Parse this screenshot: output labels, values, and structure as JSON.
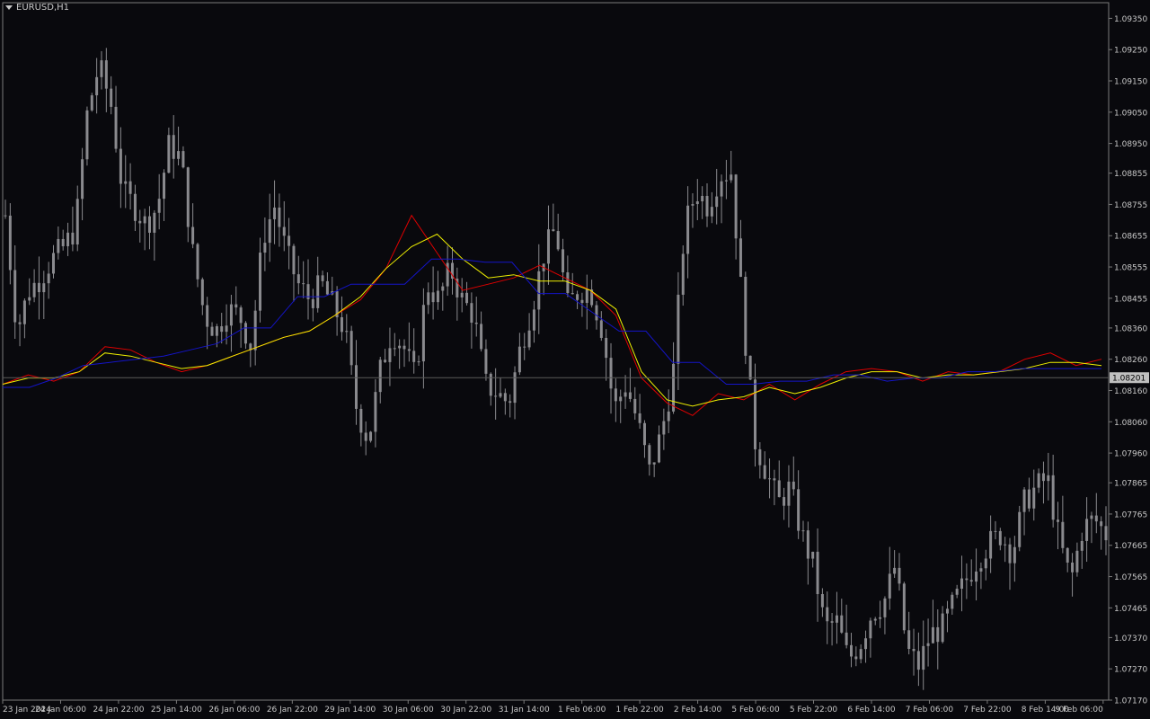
{
  "symbol_label": "EURUSD,H1",
  "colors": {
    "background": "#09090d",
    "frame": "#7a7a7a",
    "candle": "#8a8a8e",
    "text": "#c8c8c8",
    "ma_fast": "#e00000",
    "ma_mid": "#f0f000",
    "ma_step": "#1414c8",
    "price_line": "#5a5a5a",
    "price_tag_bg": "#c0c0c0",
    "price_tag_text": "#000000"
  },
  "chart_data": {
    "type": "candlestick",
    "title": "EURUSD,H1",
    "grid": false,
    "ylim": [
      1.0717,
      1.094
    ],
    "y_ticks": [
      "1.09350",
      "1.09250",
      "1.09150",
      "1.09050",
      "1.08950",
      "1.08855",
      "1.08755",
      "1.08655",
      "1.08555",
      "1.08455",
      "1.08360",
      "1.08260",
      "1.08160",
      "1.08060",
      "1.07960",
      "1.07865",
      "1.07765",
      "1.07665",
      "1.07565",
      "1.07465",
      "1.07370",
      "1.07270",
      "1.07170"
    ],
    "x_ticks": [
      "23 Jan 2024",
      "24 Jan 06:00",
      "24 Jan 22:00",
      "25 Jan 14:00",
      "26 Jan 06:00",
      "26 Jan 22:00",
      "29 Jan 14:00",
      "30 Jan 06:00",
      "30 Jan 22:00",
      "31 Jan 14:00",
      "1 Feb 06:00",
      "1 Feb 22:00",
      "2 Feb 14:00",
      "5 Feb 06:00",
      "5 Feb 22:00",
      "6 Feb 14:00",
      "7 Feb 06:00",
      "7 Feb 22:00",
      "8 Feb 14:00",
      "9 Feb 06:00"
    ],
    "current_price": "1.08201",
    "close_series": [
      1.0872,
      1.0835,
      1.0848,
      1.0852,
      1.0858,
      1.0862,
      1.0868,
      1.0905,
      1.092,
      1.0908,
      1.088,
      1.0875,
      1.0869,
      1.0875,
      1.0895,
      1.089,
      1.086,
      1.084,
      1.0835,
      1.0842,
      1.084,
      1.083,
      1.0865,
      1.0875,
      1.086,
      1.085,
      1.0845,
      1.085,
      1.0843,
      1.0835,
      1.081,
      1.08,
      1.0822,
      1.0835,
      1.083,
      1.082,
      1.085,
      1.0845,
      1.0855,
      1.0845,
      1.084,
      1.0818,
      1.0815,
      1.0812,
      1.083,
      1.0843,
      1.086,
      1.0868,
      1.0843,
      1.0848,
      1.0848,
      1.0835,
      1.081,
      1.0818,
      1.0806,
      1.079,
      1.0802,
      1.082,
      1.0868,
      1.088,
      1.0875,
      1.0885,
      1.0886,
      1.084,
      1.08,
      1.079,
      1.078,
      1.0785,
      1.077,
      1.076,
      1.074,
      1.0742,
      1.073,
      1.0735,
      1.0745,
      1.0748,
      1.076,
      1.0733,
      1.0728,
      1.0738,
      1.074,
      1.0748,
      1.0755,
      1.0762,
      1.0767,
      1.077,
      1.0764,
      1.078,
      1.0785,
      1.0788,
      1.0768,
      1.0755,
      1.0772,
      1.0775,
      1.077
    ],
    "series": [
      {
        "name": "",
        "color": "#e00000",
        "values": [
          1.0818,
          1.0821,
          1.0819,
          1.0822,
          1.083,
          1.0829,
          1.0825,
          1.0822,
          1.0824,
          1.0827,
          1.083,
          1.0833,
          1.0835,
          1.084,
          1.0845,
          1.0855,
          1.0872,
          1.086,
          1.0848,
          1.085,
          1.0852,
          1.0856,
          1.0852,
          1.0848,
          1.084,
          1.082,
          1.0812,
          1.0808,
          1.0815,
          1.0813,
          1.0818,
          1.0813,
          1.0818,
          1.0822,
          1.0823,
          1.0822,
          1.0819,
          1.0822,
          1.0821,
          1.0822,
          1.0826,
          1.0828,
          1.0824,
          1.0826
        ]
      },
      {
        "name": "",
        "color": "#f0f000",
        "values": [
          1.0818,
          1.082,
          1.082,
          1.0822,
          1.0828,
          1.0827,
          1.0825,
          1.0823,
          1.0824,
          1.0827,
          1.083,
          1.0833,
          1.0835,
          1.084,
          1.0846,
          1.0855,
          1.0862,
          1.0866,
          1.0858,
          1.0852,
          1.0853,
          1.0851,
          1.0851,
          1.0848,
          1.0842,
          1.0822,
          1.0813,
          1.0811,
          1.0813,
          1.0814,
          1.0817,
          1.0815,
          1.0817,
          1.082,
          1.0822,
          1.0822,
          1.082,
          1.0821,
          1.0821,
          1.0822,
          1.0823,
          1.0825,
          1.0825,
          1.0824
        ]
      },
      {
        "name": "",
        "color": "#1414c8",
        "values": [
          1.0817,
          1.0817,
          1.082,
          1.0824,
          1.0825,
          1.0826,
          1.0827,
          1.0829,
          1.0831,
          1.0836,
          1.0836,
          1.0846,
          1.0846,
          1.085,
          1.085,
          1.085,
          1.0858,
          1.0858,
          1.0857,
          1.0857,
          1.0847,
          1.0847,
          1.0841,
          1.0835,
          1.0835,
          1.0825,
          1.0825,
          1.0818,
          1.0818,
          1.0819,
          1.0819,
          1.0821,
          1.0821,
          1.0819,
          1.082,
          1.082,
          1.0822,
          1.0822,
          1.0823,
          1.0823,
          1.0823,
          1.0823
        ]
      }
    ]
  }
}
